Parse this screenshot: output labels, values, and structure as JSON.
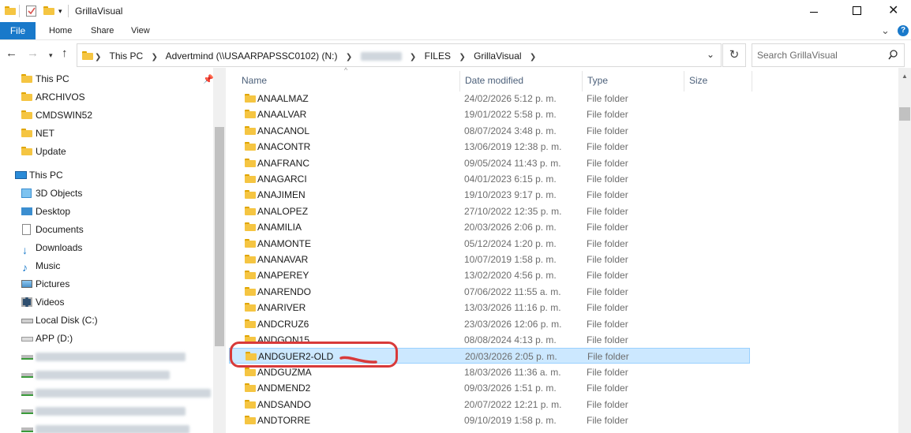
{
  "window": {
    "title": "GrillaVisual"
  },
  "ribbon": {
    "tabs": [
      "File",
      "Home",
      "Share",
      "View"
    ]
  },
  "address": {
    "crumbs": [
      "This PC",
      "Advertmind (\\\\USAARPAPSSC0102) (N:)",
      "FILES",
      "GrillaVisual"
    ]
  },
  "search": {
    "placeholder": "Search GrillaVisual"
  },
  "columns": {
    "name": "Name",
    "date": "Date modified",
    "type": "Type",
    "size": "Size"
  },
  "nav": {
    "quick": [
      "This PC",
      "ARCHIVOS",
      "CMDSWIN52",
      "NET",
      "Update"
    ],
    "thispc": [
      "This PC",
      "3D Objects",
      "Desktop",
      "Documents",
      "Downloads",
      "Music",
      "Pictures",
      "Videos",
      "Local Disk (C:)",
      "APP (D:)"
    ]
  },
  "files": [
    {
      "name": "ANAALMAZ",
      "date": "24/02/2026 5:12 p. m.",
      "type": "File folder"
    },
    {
      "name": "ANAALVAR",
      "date": "19/01/2022 5:58 p. m.",
      "type": "File folder"
    },
    {
      "name": "ANACANOL",
      "date": "08/07/2024 3:48 p. m.",
      "type": "File folder"
    },
    {
      "name": "ANACONTR",
      "date": "13/06/2019 12:38 p. m.",
      "type": "File folder"
    },
    {
      "name": "ANAFRANC",
      "date": "09/05/2024 11:43 p. m.",
      "type": "File folder"
    },
    {
      "name": "ANAGARCI",
      "date": "04/01/2023 6:15 p. m.",
      "type": "File folder"
    },
    {
      "name": "ANAJIMEN",
      "date": "19/10/2023 9:17 p. m.",
      "type": "File folder"
    },
    {
      "name": "ANALOPEZ",
      "date": "27/10/2022 12:35 p. m.",
      "type": "File folder"
    },
    {
      "name": "ANAMILIA",
      "date": "20/03/2026 2:06 p. m.",
      "type": "File folder"
    },
    {
      "name": "ANAMONTE",
      "date": "05/12/2024 1:20 p. m.",
      "type": "File folder"
    },
    {
      "name": "ANANAVAR",
      "date": "10/07/2019 1:58 p. m.",
      "type": "File folder"
    },
    {
      "name": "ANAPEREY",
      "date": "13/02/2020 4:56 p. m.",
      "type": "File folder"
    },
    {
      "name": "ANARENDO",
      "date": "07/06/2022 11:55 a. m.",
      "type": "File folder"
    },
    {
      "name": "ANARIVER",
      "date": "13/03/2026 11:16 p. m.",
      "type": "File folder"
    },
    {
      "name": "ANDCRUZ6",
      "date": "23/03/2026 12:06 p. m.",
      "type": "File folder"
    },
    {
      "name": "ANDGON15",
      "date": "08/08/2024 4:13 p. m.",
      "type": "File folder"
    },
    {
      "name": "ANDGUER2-OLD",
      "date": "20/03/2026 2:05 p. m.",
      "type": "File folder"
    },
    {
      "name": "ANDGUZMA",
      "date": "18/03/2026 11:36 a. m.",
      "type": "File folder"
    },
    {
      "name": "ANDMEND2",
      "date": "09/03/2026 1:51 p. m.",
      "type": "File folder"
    },
    {
      "name": "ANDSANDO",
      "date": "20/07/2022 12:21 p. m.",
      "type": "File folder"
    },
    {
      "name": "ANDTORRE",
      "date": "09/10/2019 1:58 p. m.",
      "type": "File folder"
    }
  ],
  "selected_index": 16,
  "colors": {
    "accent": "#1979ca",
    "selection": "#cce8ff",
    "annotation": "#d83a3a",
    "folder": "#f5c542"
  }
}
